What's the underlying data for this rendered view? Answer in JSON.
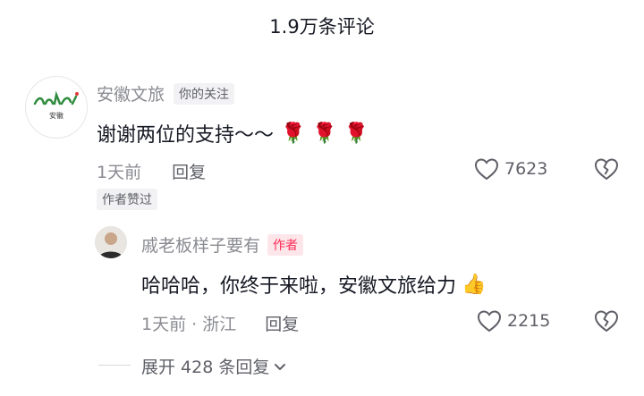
{
  "header": {
    "title": "1.9万条评论"
  },
  "comments": [
    {
      "author": "安徽文旅",
      "relation_tag": "你的关注",
      "avatar_text": "安徽",
      "content": "谢谢两位的支持～～",
      "emoji": "🌹🌹🌹",
      "time": "1天前",
      "reply_label": "回复",
      "likes": "7623",
      "author_liked_badge": "作者赞过"
    }
  ],
  "replies": [
    {
      "author": "戚老板样子要有",
      "author_tag": "作者",
      "content": "哈哈哈，你终于来啦，安徽文旅给力",
      "emoji": "👍",
      "time_location": "1天前 · 浙江",
      "reply_label": "回复",
      "likes": "2215"
    }
  ],
  "expand": {
    "label": "展开 428 条回复"
  },
  "icons": {
    "like": "heart-outline-icon",
    "dislike": "broken-heart-icon",
    "expand": "chevron-down-icon"
  },
  "colors": {
    "author_tag": "#fe2c55",
    "secondary_text": "#8a8b91"
  }
}
